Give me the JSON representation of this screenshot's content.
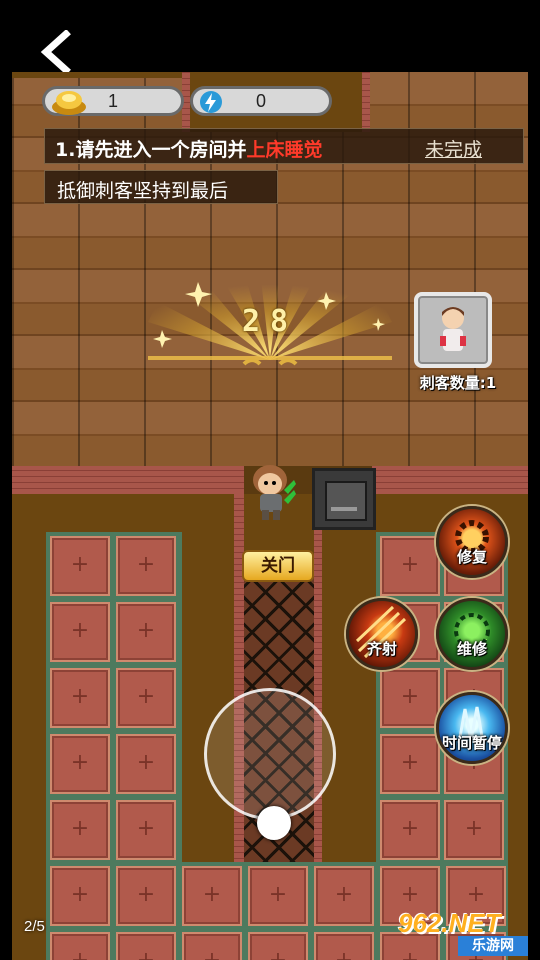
{
  "hud": {
    "gold": "1",
    "energy": "0",
    "task_text": "1.请先进入一个房间并",
    "task_highlight": "上床睡觉",
    "task_status": "未完成",
    "subtask": "抵御刺客坚持到最后"
  },
  "countdown": "28",
  "assassin": {
    "label": "刺客数量:1"
  },
  "door_button": "关门",
  "skills": {
    "repair_upgrade": "修复",
    "volley": "齐射",
    "maintain": "维修",
    "time_pause": "时间暂停"
  },
  "page_indicator": "2/5",
  "watermark": {
    "brand": "962.NET",
    "sub": "乐游网"
  },
  "colors": {
    "highlight": "#ff3a2a",
    "gold_glow": "#f5c84a",
    "status_link": "#e8e0d0"
  }
}
